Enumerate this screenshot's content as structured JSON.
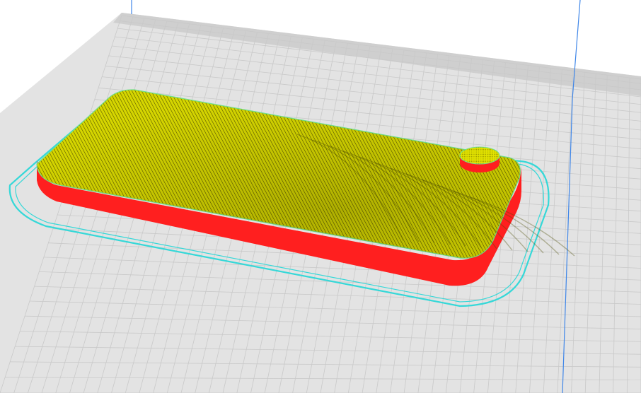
{
  "viewport": {
    "view": "layer-preview",
    "colors": {
      "background": "#ffffff",
      "build_plate": "#e3e3e3",
      "grid_line": "#c9c9c9",
      "plate_edge": "#cfcfcf",
      "volume_edge": "#3f86e8",
      "skirt": "#35d8d8",
      "wall": "#ff1f1f",
      "top_skin": "#d6d600",
      "skin_line": "#4a4a00",
      "part_outline": "#6fe08a"
    }
  }
}
